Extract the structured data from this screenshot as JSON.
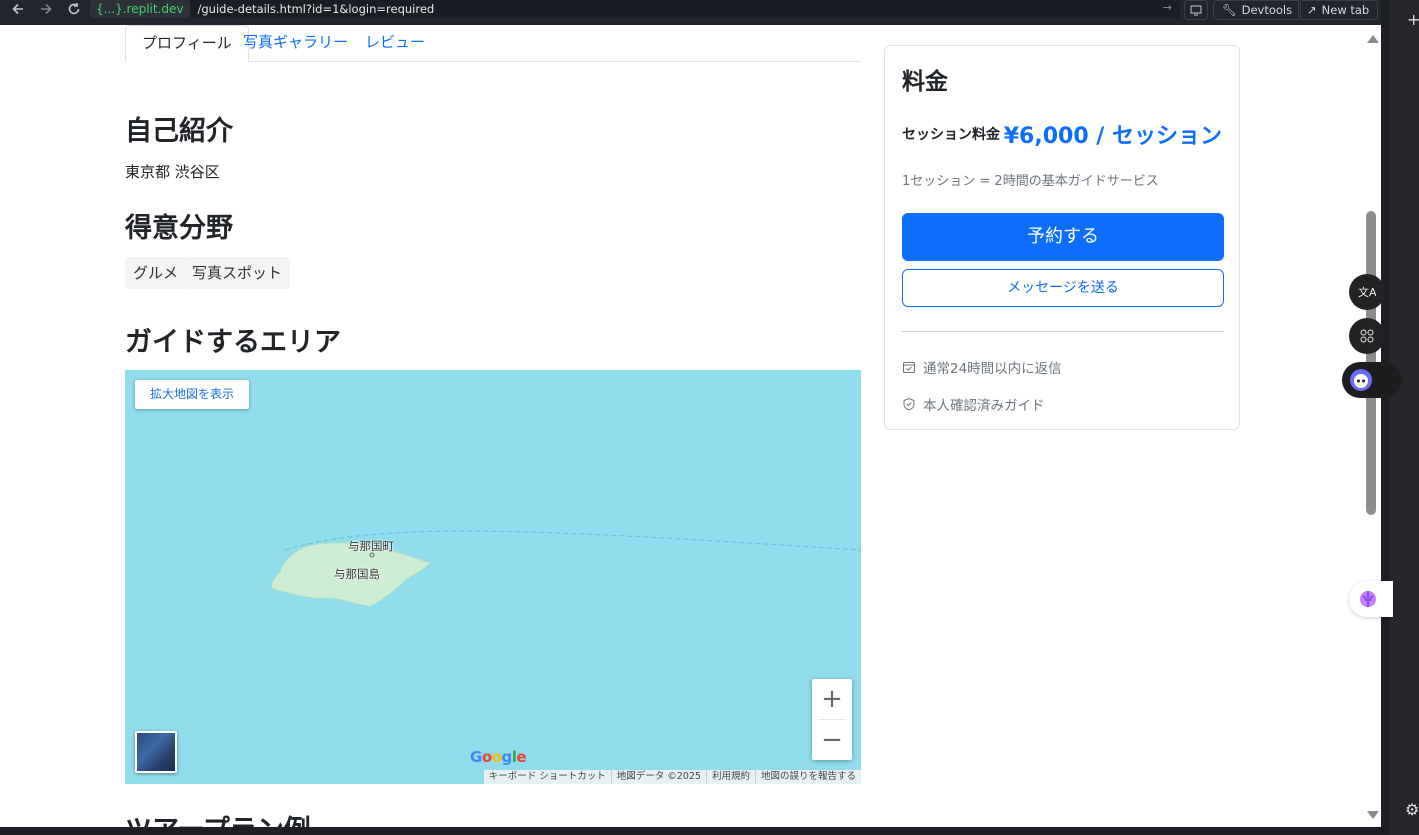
{
  "browser": {
    "url_host": "{...}.replit.dev",
    "url_path": "/guide-details.html?id=1&login=required",
    "devtools_label": "Devtools",
    "newtab_label": "New tab"
  },
  "tabs": [
    {
      "label": "プロフィール",
      "active": true
    },
    {
      "label": "写真ギャラリー",
      "active": false
    },
    {
      "label": "レビュー",
      "active": false
    }
  ],
  "profile": {
    "bio_heading": "自己紹介",
    "bio_text": "東京都 渋谷区",
    "specialties_heading": "得意分野",
    "specialties": [
      "グルメ",
      "写真スポット"
    ],
    "area_heading": "ガイドするエリア",
    "tour_heading": "ツアープラン例"
  },
  "map": {
    "enlarge_label": "拡大地図を表示",
    "zoom_in": "+",
    "zoom_out": "−",
    "town_label": "与那国町",
    "island_label": "与那国島",
    "logo": "Google",
    "attribution": [
      "キーボード ショートカット",
      "地図データ ©2025",
      "利用規約",
      "地図の誤りを報告する"
    ]
  },
  "pricing": {
    "title": "料金",
    "fee_label": "セッション料金",
    "fee_value": "¥6,000 / セッション",
    "fee_note": "1セッション = 2時間の基本ガイドサービス",
    "book_button": "予約する",
    "message_button": "メッセージを送る",
    "info": [
      "通常24時間以内に返信",
      "本人確認済みガイド"
    ]
  },
  "colors": {
    "accent": "#0d6efd",
    "map_water": "#90dbec",
    "map_land": "#cdeed4"
  }
}
